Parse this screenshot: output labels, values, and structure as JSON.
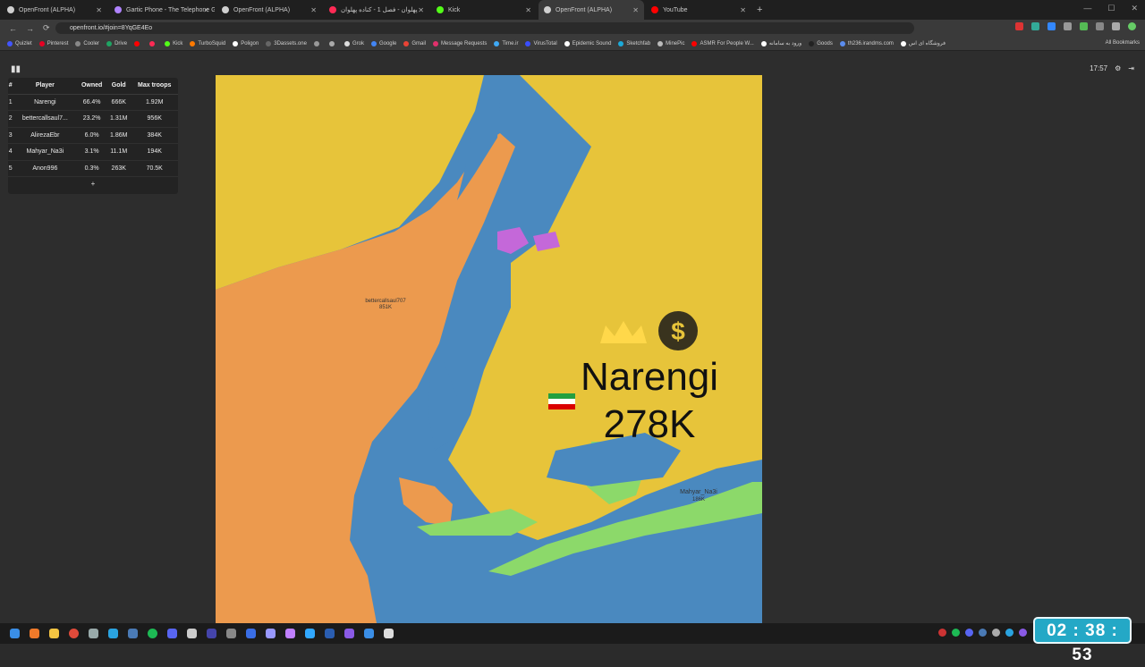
{
  "browser": {
    "tabs": [
      {
        "label": "OpenFront (ALPHA)",
        "fav_color": "#cfcfcf",
        "active": false
      },
      {
        "label": "Gartic Phone - The Telephone G",
        "fav_color": "#b083ff",
        "active": false
      },
      {
        "label": "OpenFront (ALPHA)",
        "fav_color": "#cfcfcf",
        "active": false
      },
      {
        "label": "پهلوان - فصل 1 - کناده پهلوان",
        "fav_color": "#ff2a55",
        "active": false
      },
      {
        "label": "Kick",
        "fav_color": "#53fc18",
        "active": false
      },
      {
        "label": "OpenFront (ALPHA)",
        "fav_color": "#cfcfcf",
        "active": true
      },
      {
        "label": "YouTube",
        "fav_color": "#ff0000",
        "active": false
      }
    ],
    "url": "openfront.io/#join=8YqGE4Eo",
    "bookmarks": [
      {
        "label": "Quizlet",
        "color": "#4255ff"
      },
      {
        "label": "Pinterest",
        "color": "#e60023"
      },
      {
        "label": "Cooler",
        "color": "#888888"
      },
      {
        "label": "Drive",
        "color": "#1fa463"
      },
      {
        "label": "",
        "color": "#ff0000"
      },
      {
        "label": "",
        "color": "#ff2a55"
      },
      {
        "label": "Kick",
        "color": "#53fc18"
      },
      {
        "label": "TurboSquid",
        "color": "#ff7a00"
      },
      {
        "label": "Poligon",
        "color": "#ffffff"
      },
      {
        "label": "3Dassets.one",
        "color": "#666666"
      },
      {
        "label": "",
        "color": "#999999"
      },
      {
        "label": "",
        "color": "#aaaaaa"
      },
      {
        "label": "Grok",
        "color": "#dddddd"
      },
      {
        "label": "Google",
        "color": "#4285f4"
      },
      {
        "label": "Gmail",
        "color": "#ea4335"
      },
      {
        "label": "Message Requests",
        "color": "#e1306c"
      },
      {
        "label": "Time.ir",
        "color": "#3fa9f5"
      },
      {
        "label": "VirusTotal",
        "color": "#394eff"
      },
      {
        "label": "Epidemic Sound",
        "color": "#ffffff"
      },
      {
        "label": "Sketchfab",
        "color": "#1caad9"
      },
      {
        "label": "MinePic",
        "color": "#bbbbbb"
      },
      {
        "label": "ASMR For People W...",
        "color": "#ff0000"
      },
      {
        "label": "ورود به سامانه",
        "color": "#ffffff"
      },
      {
        "label": "Goods",
        "color": "#222222"
      },
      {
        "label": "th236.irandms.com",
        "color": "#5b8def"
      },
      {
        "label": "فروشگاه ای اس",
        "color": "#ffffff"
      }
    ],
    "all_bookmarks_label": "All Bookmarks"
  },
  "leaderboard": {
    "headers": [
      "#",
      "Player",
      "Owned",
      "Gold",
      "Max troops"
    ],
    "rows": [
      [
        "1",
        "Narengi",
        "66.4%",
        "666K",
        "1.92M"
      ],
      [
        "2",
        "bettercallsaul7...",
        "23.2%",
        "1.31M",
        "956K"
      ],
      [
        "3",
        "AlirezaEbr",
        "6.0%",
        "1.86M",
        "384K"
      ],
      [
        "4",
        "Mahyar_Na3i",
        "3.1%",
        "11.1M",
        "194K"
      ],
      [
        "5",
        "Anon996",
        "0.3%",
        "263K",
        "70.5K"
      ]
    ],
    "more_label": "+"
  },
  "hud": {
    "game_time": "17:57"
  },
  "map_labels": {
    "main_player": "Narengi",
    "main_troops": "278K",
    "player2": "bettercallsaul707",
    "player2_troops": "851K",
    "player4": "Mahyar_Na3i",
    "player4_troops": "186K"
  },
  "overlay_timer": "02 : 38 : 53",
  "colors": {
    "ocean": "#4a89bf",
    "land_yellow": "#e7c43a",
    "orange_player": "#ec9a4e",
    "green_player": "#8cd96a",
    "purple_player": "#c468d9",
    "timer_bg": "#24a8c6"
  }
}
